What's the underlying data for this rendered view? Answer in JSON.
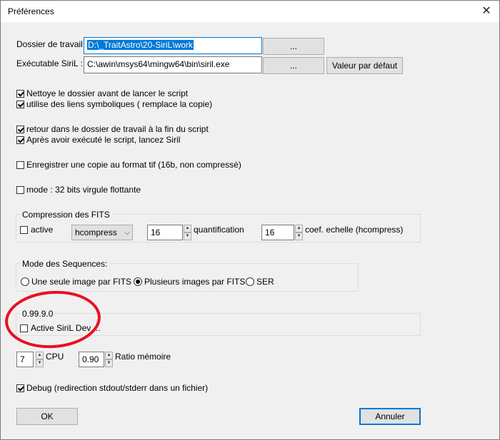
{
  "window": {
    "title": "Préférences",
    "close_glyph": "✕"
  },
  "paths": {
    "workdir_label": "Dossier de travail:",
    "workdir_value": "D:\\_TraitAstro\\20-SiriL\\work",
    "exec_label": "Exécutable SiriL :",
    "exec_value": "C:\\awin\\msys64\\mingw64\\bin\\siril.exe",
    "browse_label": "...",
    "default_label": "Valeur par défaut"
  },
  "options": {
    "clean_dir": "Nettoye le  dossier avant de  lancer le script",
    "symlinks": "utilise des liens symboliques ( remplace la copie)",
    "return_dir": "retour dans le dossier de travail à la fin du script",
    "launch_siril": "Après avoir exécuté le script, lancez Siril",
    "save_tif": "Enregistrer une copie au format tif (16b, non compressé)",
    "float32": "mode : 32 bits virgule flottante"
  },
  "compression": {
    "title": "Compression des FITS",
    "active_label": "active",
    "method": "hcompress",
    "quantification_value": "16",
    "quantification_label": "quantification",
    "scale_value": "16",
    "scale_label": "coef. echelle (hcompress)"
  },
  "sequences": {
    "title": "Mode des Sequences:",
    "single": "Une seule image par FITS",
    "multi": "Plusieurs images par FITS",
    "ser": "SER"
  },
  "dev": {
    "version": "0.99.9.0",
    "label": "Active SiriL Dev ..."
  },
  "resources": {
    "cpu_value": "7",
    "cpu_label": "CPU",
    "ratio_value": "0.90",
    "ratio_label": "Ratio mémoire"
  },
  "debug": {
    "label": "Debug (redirection stdout/stderr dans un fichier)"
  },
  "footer": {
    "ok_label": "OK",
    "cancel_label": "Annuler"
  },
  "colors": {
    "accent": "#0078d7",
    "annotation": "#e81123"
  }
}
